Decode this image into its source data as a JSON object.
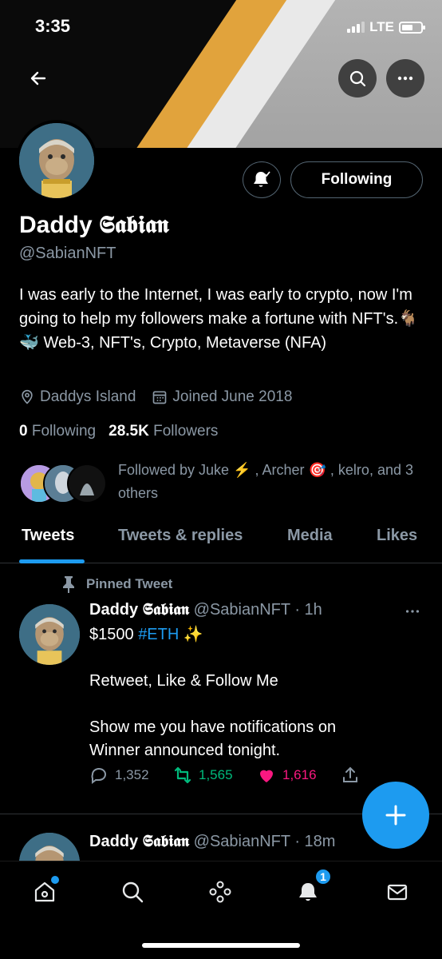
{
  "status_bar": {
    "time": "3:35",
    "network": "LTE"
  },
  "profile": {
    "name": "Daddy 𝕾𝖆𝖇𝖎𝖆𝖓",
    "handle": "@SabianNFT",
    "follow_button": "Following",
    "bio": "I was early to the Internet, I was early to crypto, now I'm going to help my followers make a fortune with NFT's.🐐🐳 Web-3, NFT's, Crypto, Metaverse (NFA)",
    "location": "Daddys Island",
    "joined": "Joined June 2018",
    "following_count": "0",
    "following_label": "Following",
    "followers_count": "28.5K",
    "followers_label": "Followers",
    "followed_by": "Followed by Juke ⚡️ , Archer 🎯 , kelro, and 3 others"
  },
  "tabs": [
    {
      "label": "Tweets",
      "active": true
    },
    {
      "label": "Tweets & replies",
      "active": false
    },
    {
      "label": "Media",
      "active": false
    },
    {
      "label": "Likes",
      "active": false
    }
  ],
  "tweets": [
    {
      "pinned_label": "Pinned Tweet",
      "author": "Daddy 𝕾𝖆𝖇𝖎𝖆𝖓",
      "handle": "@SabianNFT",
      "time": "· 1h",
      "line1_prefix": "$1500",
      "hashtag": "#ETH",
      "line1_suffix": "✨",
      "line2": "Retweet, Like & Follow Me",
      "line3": "Show me you have notifications on",
      "line4": "Winner announced tonight.",
      "replies": "1,352",
      "retweets": "1,565",
      "likes": "1,616"
    },
    {
      "author": "Daddy 𝕾𝖆𝖇𝖎𝖆𝖓",
      "handle": "@SabianNFT",
      "time": "· 18m"
    }
  ],
  "nav": {
    "notifications_badge": "1"
  },
  "colors": {
    "accent": "#1d9bf0",
    "retweet": "#00ba7c",
    "like": "#f91880",
    "muted": "#8b98a5"
  }
}
